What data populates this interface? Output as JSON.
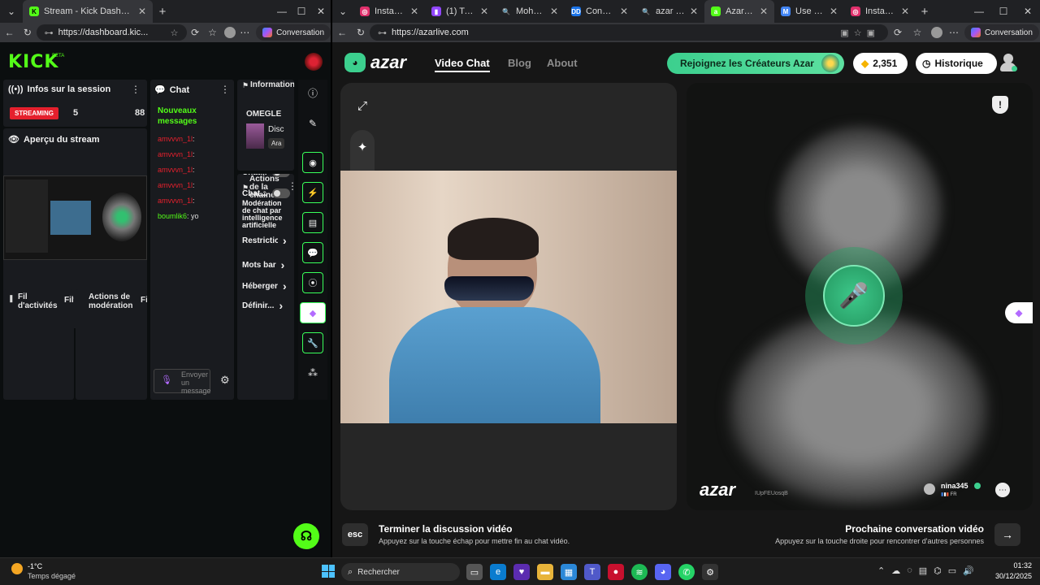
{
  "left_window": {
    "tab_title": "Stream - Kick Dashboard",
    "url": "https://dashboard.kic...",
    "conversation_label": "Conversation"
  },
  "right_window": {
    "tabs": [
      {
        "label": "Instagram",
        "color": "#e1306c",
        "glyph": "◎"
      },
      {
        "label": "(1) Twitch",
        "color": "#9146ff",
        "glyph": "▮"
      },
      {
        "label": "Mohamed Ra",
        "color": "#202124",
        "glyph": "🔍"
      },
      {
        "label": "Convertisseur",
        "color": "#1a73e8",
        "glyph": "DD"
      },
      {
        "label": "azar - Recher",
        "color": "#202124",
        "glyph": "🔍"
      },
      {
        "label": "Azar : Ch",
        "color": "#53fc18",
        "glyph": "a"
      },
      {
        "label": "Use OTP To P",
        "color": "#4285f4",
        "glyph": "M"
      },
      {
        "label": "Instagram",
        "color": "#e1306c",
        "glyph": "◎"
      }
    ],
    "url": "https://azarlive.com",
    "conversation_label": "Conversation"
  },
  "kick": {
    "logo": "KICK",
    "beta": "BETA",
    "session": {
      "title": "Infos sur la session",
      "status": "STREAMING",
      "viewers": "5",
      "count2": "88"
    },
    "preview_title": "Aperçu du stream",
    "activity_title": "Fil d'activités",
    "activity_filter": "Filt",
    "moderation_title": "Actions de modération",
    "moderation_filter": "Fil",
    "chat": {
      "title": "Chat",
      "new_messages": "Nouveaux messages",
      "messages": [
        {
          "user": "amvvvn_1l",
          "text": ":"
        },
        {
          "user": "amvvvn_1l",
          "text": ":"
        },
        {
          "user": "amvvvn_1l",
          "text": ":"
        },
        {
          "user": "amvvvn_1l",
          "text": ":"
        },
        {
          "user": "amvvvn_1l",
          "text": ":"
        },
        {
          "user": "boumlik6",
          "text": ": yo"
        }
      ],
      "input_placeholder": "Envoyer un message"
    },
    "stream_info": {
      "title": "Informations sur le stream",
      "category": "OMEGLE",
      "line1": "Disc",
      "tag": "Ara"
    },
    "channel_actions": {
      "title": "Actions de la chaîne",
      "items": [
        "Mode len",
        "Chat pou",
        "Chat...",
        "Chat...",
        "Modération de chat par intelligence artificielle",
        "Restrictio",
        "Mots bar",
        "Héberger une",
        "Définir..."
      ]
    }
  },
  "azar": {
    "nav": {
      "brand": "azar",
      "video_chat": "Video Chat",
      "blog": "Blog",
      "about": "About"
    },
    "creators_button": "Rejoignez les Créateurs Azar",
    "gems": "2,351",
    "history_button": "Historique",
    "watermark": "azar",
    "watermark_id": "IUpFEUosqB",
    "partner": {
      "name": "nina345",
      "country": "FR"
    },
    "end_key": "esc",
    "end_title": "Terminer la discussion vidéo",
    "end_desc": "Appuyez sur la touche échap pour mettre fin au chat vidéo.",
    "next_title": "Prochaine conversation vidéo",
    "next_desc": "Appuyez sur la touche droite pour rencontrer d'autres personnes"
  },
  "taskbar": {
    "weather_temp": "-1°C",
    "weather_desc": "Temps dégagé",
    "search_placeholder": "Rechercher",
    "time": "01:32",
    "date": "30/12/2025"
  },
  "colors": {
    "kick_green": "#53fc18",
    "azar_green": "#3ccf8e",
    "streaming_red": "#e5202d"
  }
}
